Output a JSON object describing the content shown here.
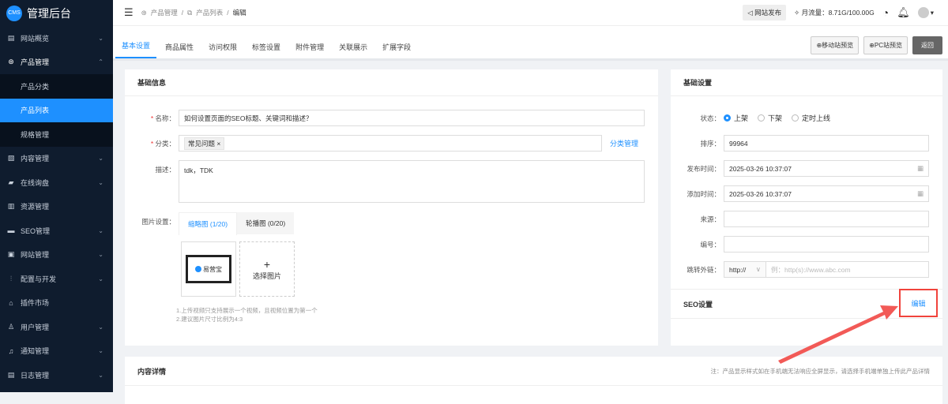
{
  "app": {
    "logo_badge": "CMS",
    "title": "管理后台"
  },
  "sidebar": {
    "items": [
      {
        "label": "网站概览",
        "icon": "dashboard-icon"
      },
      {
        "label": "产品管理",
        "icon": "product-icon",
        "expanded": true,
        "children": [
          "产品分类",
          "产品列表",
          "规格管理"
        ]
      },
      {
        "label": "内容管理",
        "icon": "content-icon"
      },
      {
        "label": "在线询盘",
        "icon": "chat-icon"
      },
      {
        "label": "资源管理",
        "icon": "resource-icon"
      },
      {
        "label": "SEO管理",
        "icon": "seo-icon"
      },
      {
        "label": "网站管理",
        "icon": "site-icon"
      },
      {
        "label": "配置与开发",
        "icon": "config-icon"
      },
      {
        "label": "插件市场",
        "icon": "plugin-icon"
      },
      {
        "label": "用户管理",
        "icon": "user-icon"
      },
      {
        "label": "通知管理",
        "icon": "notify-icon"
      },
      {
        "label": "日志管理",
        "icon": "log-icon"
      }
    ]
  },
  "header": {
    "breadcrumb": [
      "产品管理",
      "产品列表",
      "编辑"
    ],
    "publish": "网站发布",
    "traffic": "月流量：8.71G/100.00G"
  },
  "tabs": [
    "基本设置",
    "商品属性",
    "访问权限",
    "标签设置",
    "附件管理",
    "关联展示",
    "扩展字段"
  ],
  "actions": {
    "mobile_preview": "⊕移动站预览",
    "pc_preview": "⊕PC站预览",
    "back": "返回"
  },
  "basic": {
    "title": "基础信息",
    "name_label": "名称：",
    "name_value": "如何设置页面的SEO标题、关键词和描述？",
    "category_label": "分类：",
    "category_tag": "常见问题",
    "category_manage": "分类管理",
    "desc_label": "描述：",
    "desc_value": "tdk，TDK",
    "image_label": "图片设置：",
    "image_tabs": [
      "缩略图 (1/20)",
      "轮播图 (0/20)"
    ],
    "thumb_brand": "易营宝",
    "select_image": "选择图片",
    "tips": [
      "1.上传视频只支持展示一个视频，且视频位置为第一个",
      "2.建议图片尺寸比例为4:3"
    ]
  },
  "settings": {
    "title": "基础设置",
    "status_label": "状态：",
    "status_options": [
      "上架",
      "下架",
      "定时上线"
    ],
    "status_selected": "上架",
    "order_label": "排序：",
    "order_value": "99964",
    "publish_time_label": "发布时间：",
    "publish_time": "2025-03-26 10:37:07",
    "add_time_label": "添加时间：",
    "add_time": "2025-03-26 10:37:07",
    "source_label": "来源：",
    "number_label": "编号：",
    "link_label": "跳转外链：",
    "link_protocol": "http://",
    "link_placeholder": "例：http(s)://www.abc.com"
  },
  "seo": {
    "title": "SEO设置",
    "edit": "编辑"
  },
  "content": {
    "title": "内容详情",
    "note": "注：产品显示样式如在手机端无法响应全屏显示，请选择手机端单独上传此产品详情"
  }
}
